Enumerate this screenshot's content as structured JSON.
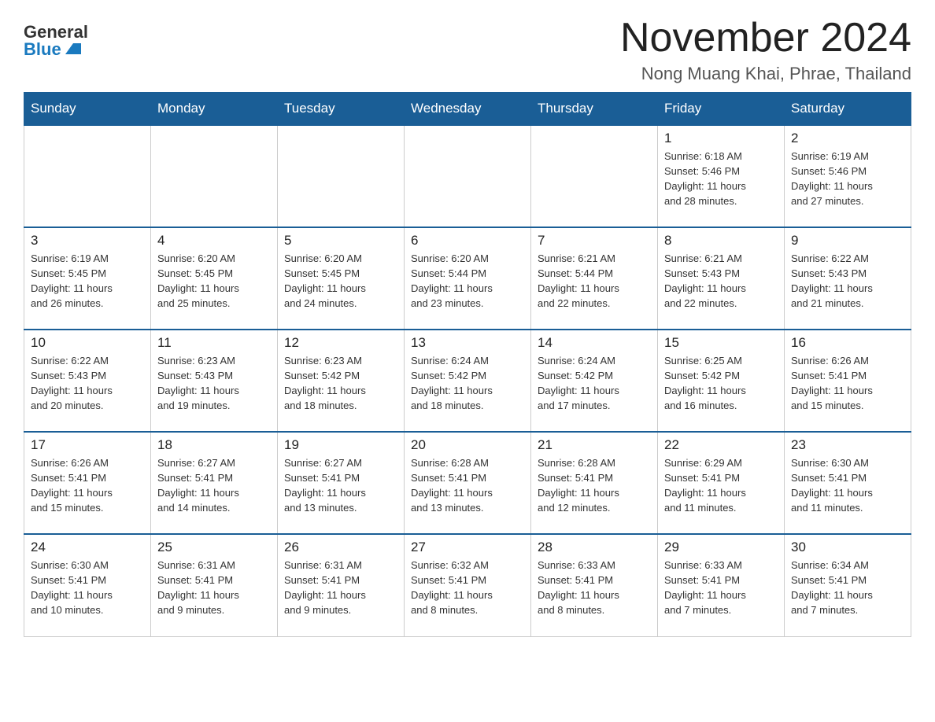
{
  "header": {
    "logo_general": "General",
    "logo_blue": "Blue",
    "month_title": "November 2024",
    "location": "Nong Muang Khai, Phrae, Thailand"
  },
  "days_of_week": [
    "Sunday",
    "Monday",
    "Tuesday",
    "Wednesday",
    "Thursday",
    "Friday",
    "Saturday"
  ],
  "weeks": [
    [
      {
        "day": "",
        "info": ""
      },
      {
        "day": "",
        "info": ""
      },
      {
        "day": "",
        "info": ""
      },
      {
        "day": "",
        "info": ""
      },
      {
        "day": "",
        "info": ""
      },
      {
        "day": "1",
        "info": "Sunrise: 6:18 AM\nSunset: 5:46 PM\nDaylight: 11 hours\nand 28 minutes."
      },
      {
        "day": "2",
        "info": "Sunrise: 6:19 AM\nSunset: 5:46 PM\nDaylight: 11 hours\nand 27 minutes."
      }
    ],
    [
      {
        "day": "3",
        "info": "Sunrise: 6:19 AM\nSunset: 5:45 PM\nDaylight: 11 hours\nand 26 minutes."
      },
      {
        "day": "4",
        "info": "Sunrise: 6:20 AM\nSunset: 5:45 PM\nDaylight: 11 hours\nand 25 minutes."
      },
      {
        "day": "5",
        "info": "Sunrise: 6:20 AM\nSunset: 5:45 PM\nDaylight: 11 hours\nand 24 minutes."
      },
      {
        "day": "6",
        "info": "Sunrise: 6:20 AM\nSunset: 5:44 PM\nDaylight: 11 hours\nand 23 minutes."
      },
      {
        "day": "7",
        "info": "Sunrise: 6:21 AM\nSunset: 5:44 PM\nDaylight: 11 hours\nand 22 minutes."
      },
      {
        "day": "8",
        "info": "Sunrise: 6:21 AM\nSunset: 5:43 PM\nDaylight: 11 hours\nand 22 minutes."
      },
      {
        "day": "9",
        "info": "Sunrise: 6:22 AM\nSunset: 5:43 PM\nDaylight: 11 hours\nand 21 minutes."
      }
    ],
    [
      {
        "day": "10",
        "info": "Sunrise: 6:22 AM\nSunset: 5:43 PM\nDaylight: 11 hours\nand 20 minutes."
      },
      {
        "day": "11",
        "info": "Sunrise: 6:23 AM\nSunset: 5:43 PM\nDaylight: 11 hours\nand 19 minutes."
      },
      {
        "day": "12",
        "info": "Sunrise: 6:23 AM\nSunset: 5:42 PM\nDaylight: 11 hours\nand 18 minutes."
      },
      {
        "day": "13",
        "info": "Sunrise: 6:24 AM\nSunset: 5:42 PM\nDaylight: 11 hours\nand 18 minutes."
      },
      {
        "day": "14",
        "info": "Sunrise: 6:24 AM\nSunset: 5:42 PM\nDaylight: 11 hours\nand 17 minutes."
      },
      {
        "day": "15",
        "info": "Sunrise: 6:25 AM\nSunset: 5:42 PM\nDaylight: 11 hours\nand 16 minutes."
      },
      {
        "day": "16",
        "info": "Sunrise: 6:26 AM\nSunset: 5:41 PM\nDaylight: 11 hours\nand 15 minutes."
      }
    ],
    [
      {
        "day": "17",
        "info": "Sunrise: 6:26 AM\nSunset: 5:41 PM\nDaylight: 11 hours\nand 15 minutes."
      },
      {
        "day": "18",
        "info": "Sunrise: 6:27 AM\nSunset: 5:41 PM\nDaylight: 11 hours\nand 14 minutes."
      },
      {
        "day": "19",
        "info": "Sunrise: 6:27 AM\nSunset: 5:41 PM\nDaylight: 11 hours\nand 13 minutes."
      },
      {
        "day": "20",
        "info": "Sunrise: 6:28 AM\nSunset: 5:41 PM\nDaylight: 11 hours\nand 13 minutes."
      },
      {
        "day": "21",
        "info": "Sunrise: 6:28 AM\nSunset: 5:41 PM\nDaylight: 11 hours\nand 12 minutes."
      },
      {
        "day": "22",
        "info": "Sunrise: 6:29 AM\nSunset: 5:41 PM\nDaylight: 11 hours\nand 11 minutes."
      },
      {
        "day": "23",
        "info": "Sunrise: 6:30 AM\nSunset: 5:41 PM\nDaylight: 11 hours\nand 11 minutes."
      }
    ],
    [
      {
        "day": "24",
        "info": "Sunrise: 6:30 AM\nSunset: 5:41 PM\nDaylight: 11 hours\nand 10 minutes."
      },
      {
        "day": "25",
        "info": "Sunrise: 6:31 AM\nSunset: 5:41 PM\nDaylight: 11 hours\nand 9 minutes."
      },
      {
        "day": "26",
        "info": "Sunrise: 6:31 AM\nSunset: 5:41 PM\nDaylight: 11 hours\nand 9 minutes."
      },
      {
        "day": "27",
        "info": "Sunrise: 6:32 AM\nSunset: 5:41 PM\nDaylight: 11 hours\nand 8 minutes."
      },
      {
        "day": "28",
        "info": "Sunrise: 6:33 AM\nSunset: 5:41 PM\nDaylight: 11 hours\nand 8 minutes."
      },
      {
        "day": "29",
        "info": "Sunrise: 6:33 AM\nSunset: 5:41 PM\nDaylight: 11 hours\nand 7 minutes."
      },
      {
        "day": "30",
        "info": "Sunrise: 6:34 AM\nSunset: 5:41 PM\nDaylight: 11 hours\nand 7 minutes."
      }
    ]
  ]
}
